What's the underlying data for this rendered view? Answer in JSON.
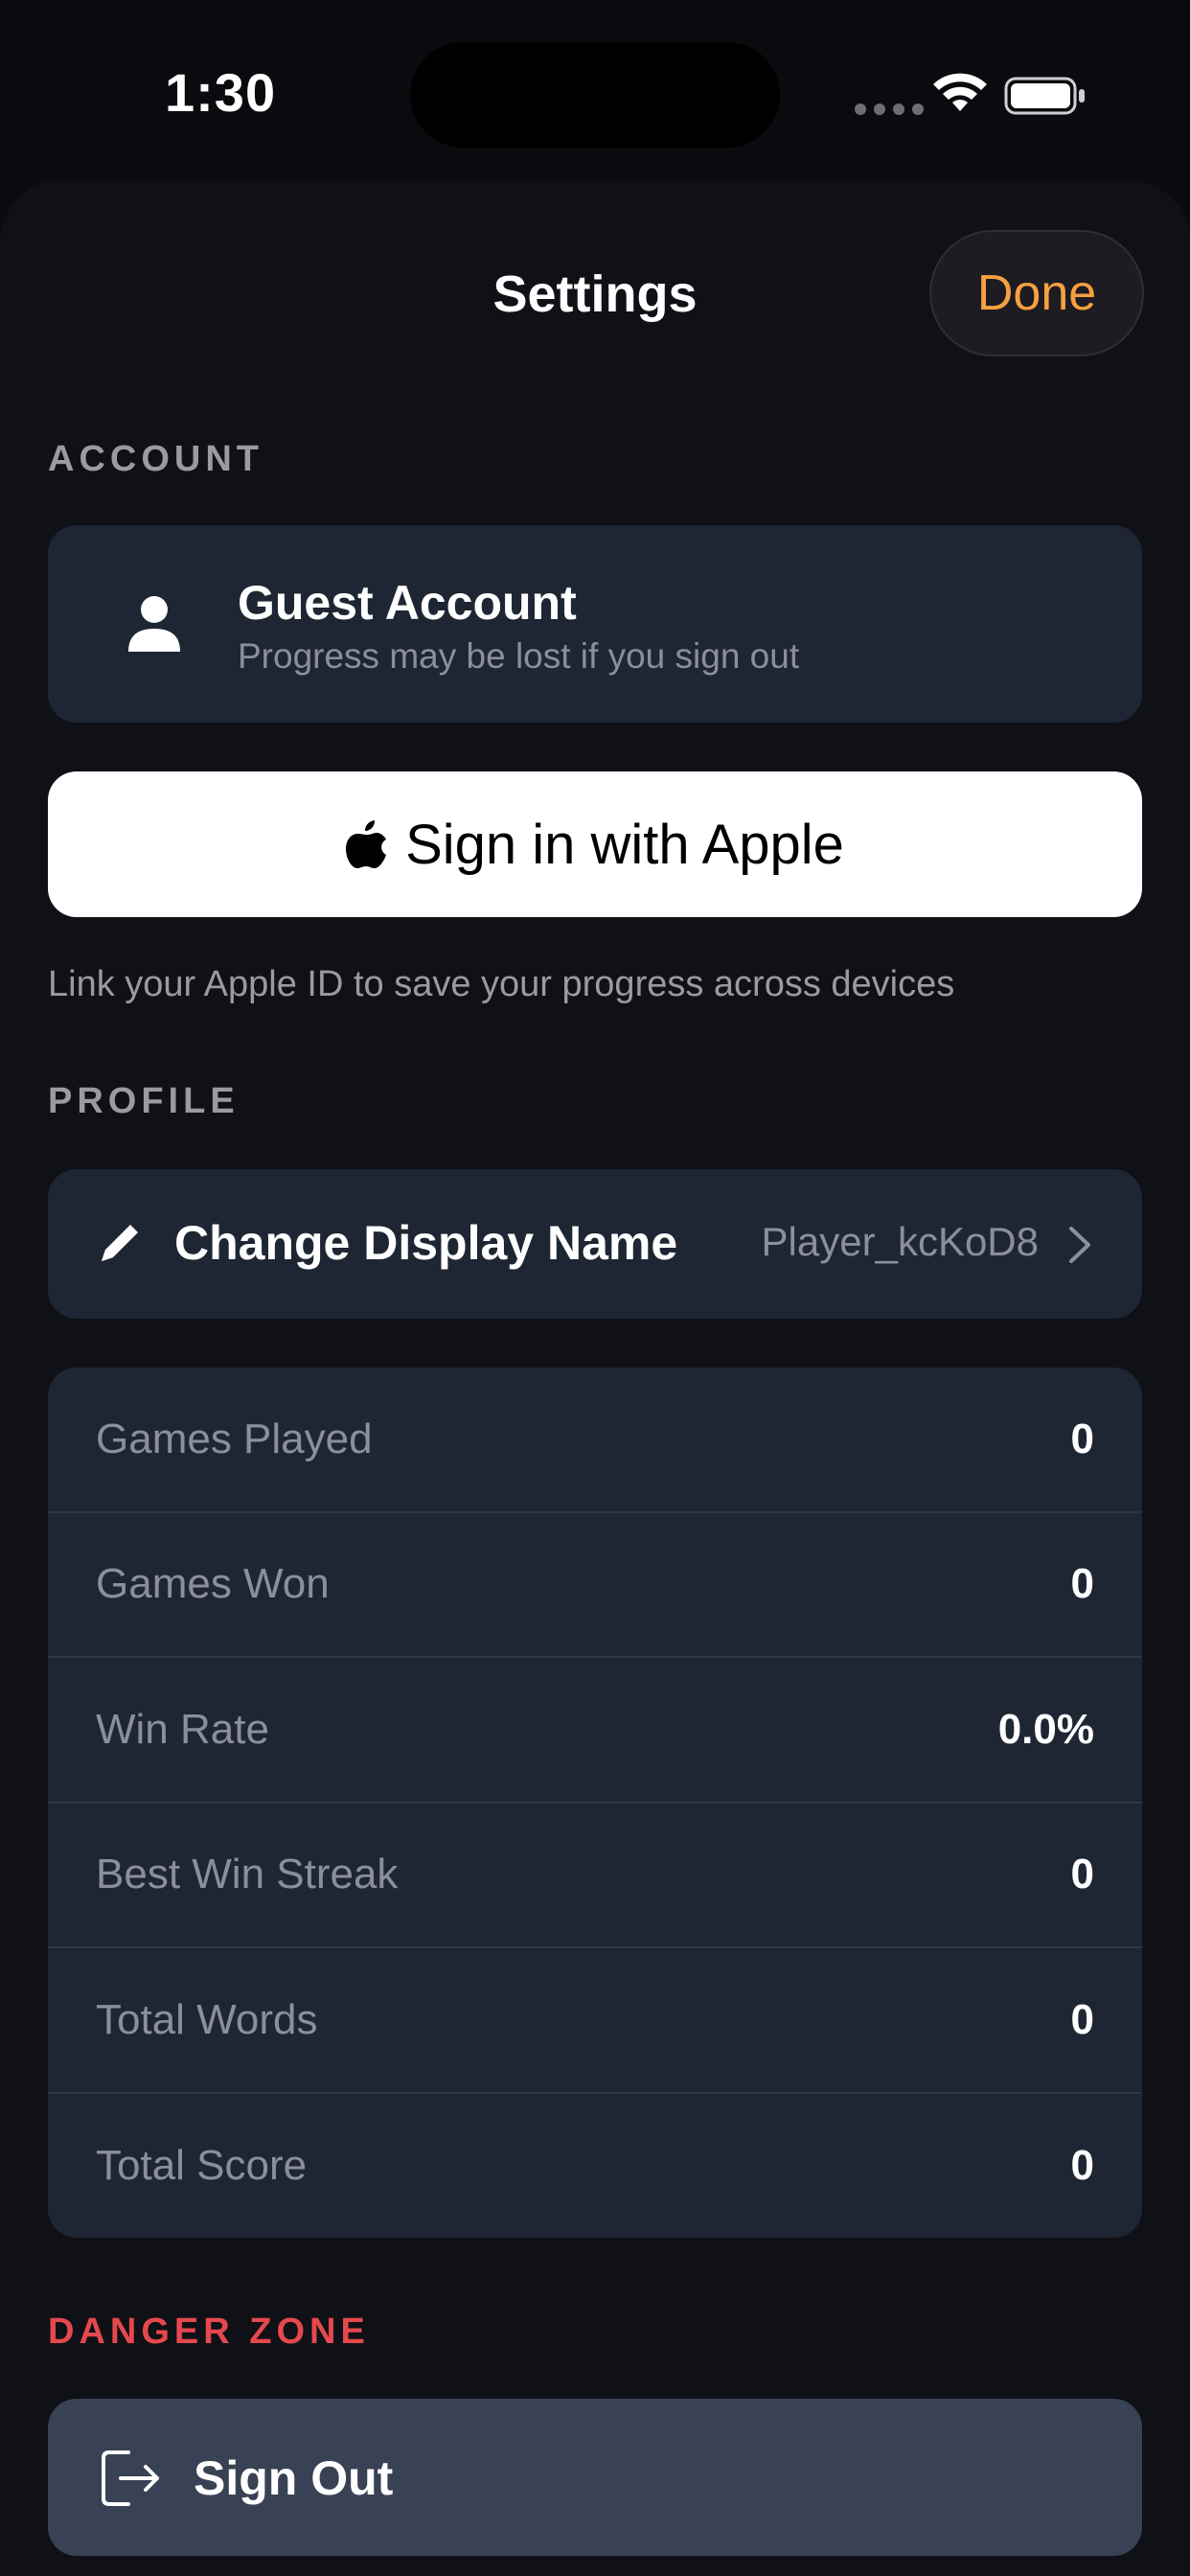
{
  "status_bar": {
    "time": "1:30"
  },
  "header": {
    "title": "Settings",
    "done_label": "Done"
  },
  "account": {
    "section_label": "ACCOUNT",
    "title": "Guest Account",
    "subtitle": "Progress may be lost if you sign out",
    "apple_button_label": "Sign in with Apple",
    "helper_text": "Link your Apple ID to save your progress across devices"
  },
  "profile": {
    "section_label": "PROFILE",
    "change_name_label": "Change Display Name",
    "display_name": "Player_kcKoD8",
    "stats": [
      {
        "label": "Games Played",
        "value": "0"
      },
      {
        "label": "Games Won",
        "value": "0"
      },
      {
        "label": "Win Rate",
        "value": "0.0%"
      },
      {
        "label": "Best Win Streak",
        "value": "0"
      },
      {
        "label": "Total Words",
        "value": "0"
      },
      {
        "label": "Total Score",
        "value": "0"
      }
    ]
  },
  "danger_zone": {
    "section_label": "DANGER ZONE",
    "sign_out_label": "Sign Out"
  },
  "colors": {
    "accent": "#f7a041",
    "danger": "#e5484d",
    "card": "#1f2633",
    "background": "#0f1117"
  },
  "icons": [
    "wifi-icon",
    "battery-icon",
    "person-icon",
    "apple-icon",
    "pencil-icon",
    "chevron-right-icon",
    "sign-out-icon"
  ]
}
